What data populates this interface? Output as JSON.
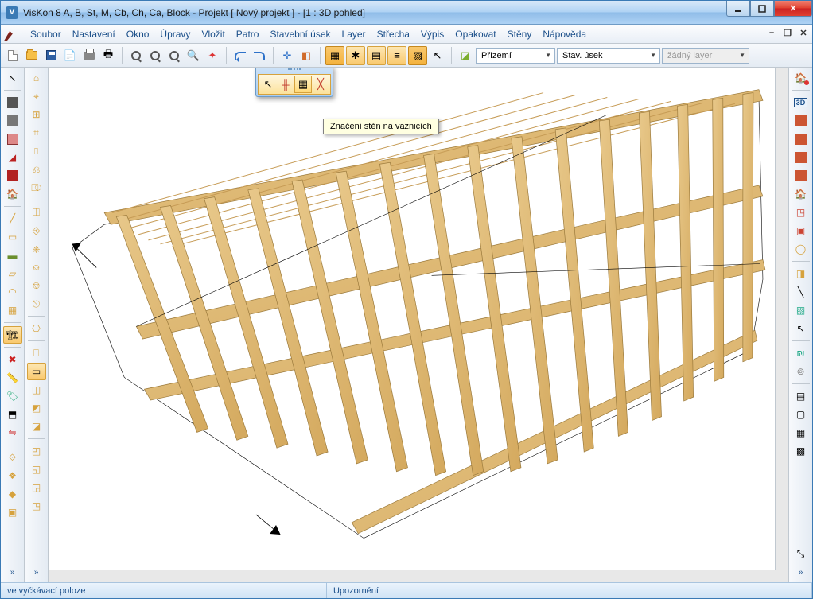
{
  "window": {
    "title": "VisKon 8 A, B, St, M, Cb, Ch, Ca, Block - Projekt [ Nový projekt ]  - [1 : 3D pohled]"
  },
  "menu": {
    "items": [
      "Soubor",
      "Nastavení",
      "Okno",
      "Úpravy",
      "Vložit",
      "Patro",
      "Stavební úsek",
      "Layer",
      "Střecha",
      "Výpis",
      "Opakovat",
      "Stěny",
      "Nápověda"
    ]
  },
  "toolbar": {
    "dropdowns": {
      "floor": "Přízemí",
      "section": "Stav. úsek",
      "layer": "žádný layer"
    }
  },
  "tooltip": {
    "text": "Značení stěn na vaznicích"
  },
  "status": {
    "left": "ve vyčkávací poloze",
    "center": "Upozornění",
    "right": ""
  },
  "right_panel": {
    "label3d": "3D"
  }
}
